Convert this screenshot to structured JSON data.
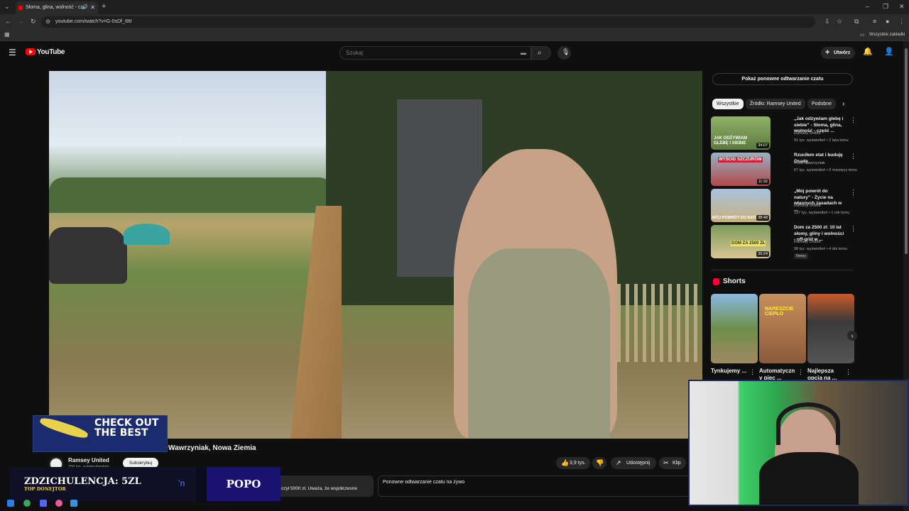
{
  "browser": {
    "tab_title": "Słoma, glina, wolność - cz",
    "url": "youtube.com/watch?v=G-0sDf_I8tI",
    "bookmarks_label": "Wszystkie zakładki"
  },
  "youtube": {
    "logo_text": "YouTube",
    "search_placeholder": "Szukaj",
    "create_label": "Utwórz"
  },
  "video": {
    "title_visible": "Wawrzyniak, Nowa Ziemia",
    "channel": "Ramsey United",
    "subscribers": "150 tys. subskrybentów",
    "subscribe_label": "Subskrybuj",
    "likes": "3,9 tys.",
    "share_label": "Udostępnij",
    "clip_label": "Klip",
    "description_snippet": "czył 5000 zł. Uważa, że współczesne",
    "chat_replay_title": "Ponowne odtwarzanie czatu na żywo"
  },
  "sidebar": {
    "chat_replay_button": "Pokaż ponowne odtwarzanie czatu",
    "chips": [
      "Wszystkie",
      "Źródło: Ramsey United",
      "Podobne"
    ],
    "recommendations": [
      {
        "title": "„Jak odżywiam glebę i siebie” - Słoma, glina, wolność - część ...",
        "channel": "Ramsey United",
        "meta": "91 tys. wyświetleń • 2 lata temu",
        "duration": "34:07",
        "thumb_text": "JAK ODŻYWIAM GLEBĘ I SIEBIE"
      },
      {
        "title": "Rzuciłem etat i buduję Osadę",
        "channel": "Kuba Wawrzyniak",
        "meta": "67 tys. wyświetleń • 9 miesięcy temu",
        "duration": "11:32",
        "thumb_text": "WYŚCIG SZCZURÓW"
      },
      {
        "title": "„Mój powrót do natury” - Życie na własnych zasadach w ...",
        "channel": "Ramsey United",
        "meta": "197 tys. wyświetleń • 1 rok temu",
        "duration": "38:48",
        "thumb_text": "MÓJ POWRÓT DO NATURY"
      },
      {
        "title": "Dom za 2500 zł: 10 lat słomy, gliny i wolności - off-grid w ...",
        "channel": "Ramsey United",
        "meta": "98 tys. wyświetleń • 4 dni temu",
        "duration": "36:24",
        "badge": "Nowy",
        "thumb_text": "DOM ZA 2500 ZŁ"
      }
    ],
    "shorts_heading": "Shorts",
    "shorts": [
      {
        "title": "Tynkujemy ...",
        "thumb_text": ""
      },
      {
        "title": "Automatyczn y piec ...",
        "thumb_text": "NARESZCIE CIEPŁO"
      },
      {
        "title": "Najlepsza opcja na ...",
        "thumb_text": ""
      }
    ]
  },
  "overlays": {
    "promo_text": "CHECK OUT THE BEST",
    "donation_text": "ZDZICHULENCJA: 5ZL",
    "donation_sub": "TOP DONEJTOR",
    "donation_right": "POPO"
  }
}
